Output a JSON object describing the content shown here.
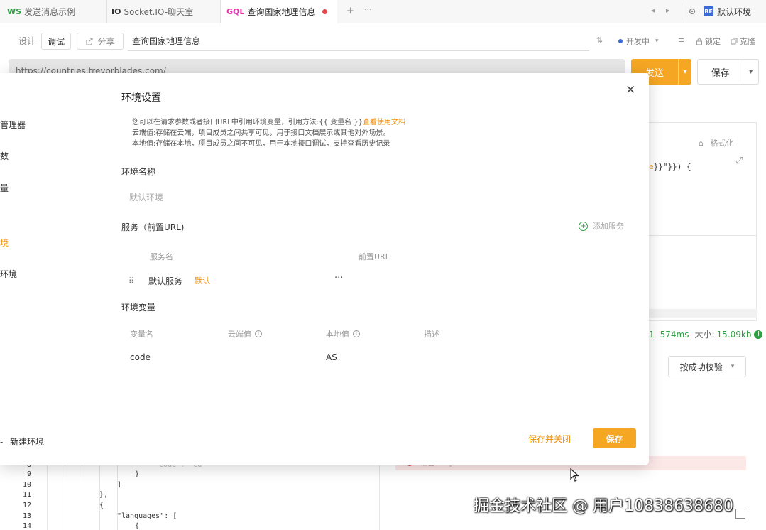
{
  "tabs": [
    {
      "proto": "WS",
      "label": "发送消息示例"
    },
    {
      "proto": "IO",
      "label": "Socket.IO-聊天室"
    },
    {
      "proto": "GQL",
      "label": "查询国家地理信息"
    }
  ],
  "tabbar": {
    "add": "+",
    "more": "···",
    "prev": "◂",
    "next": "▸",
    "env_badge": "BE",
    "env_label": "默认环境"
  },
  "toolbar": {
    "design": "设计",
    "debug": "调试",
    "share": "分享",
    "request_name": "查询国家地理信息",
    "env": "开发中",
    "lock": "锁定",
    "clone": "克隆"
  },
  "url": {
    "value": "https://countries.trevorblades.com/"
  },
  "actions": {
    "send": "发送",
    "save": "保存"
  },
  "bg_right": {
    "format": "格式化",
    "code_fragment_orange": "e",
    "code_fragment_rest": "}}\"}}) {",
    "status_code_tail": "1",
    "time": "574ms",
    "size_label": "大小:",
    "size_value": "15.09kb",
    "validate": "按成功校验"
  },
  "sidebar": {
    "items": [
      {
        "label": "管理器"
      },
      {
        "label": "数"
      },
      {
        "label": "量"
      },
      {
        "label": "境"
      },
      {
        "label": "环境"
      }
    ],
    "new_env": "新建环境"
  },
  "modal": {
    "title": "环境设置",
    "desc_line1": "您可以在请求参数或者接口URL中引用环境变量，引用方法:{{ 变量名 }}",
    "desc_link": "查看使用文档",
    "desc_line2": "云端值:存储在云端，项目成员之间共享可见，用于接口文档展示或其他对外场景。",
    "desc_line3": "本地值:存储在本地，项目成员之间不可见，用于本地接口调试，支持查看历史记录",
    "env_name_label": "环境名称",
    "env_name_value": "默认环境",
    "service_label": "服务（前置URL)",
    "add_service": "添加服务",
    "service_cols": {
      "name": "服务名",
      "url": "前置URL"
    },
    "service_row": {
      "name": "默认服务",
      "tag": "默认"
    },
    "vars_label": "环境变量",
    "var_cols": {
      "name": "变量名",
      "cloud": "云端值",
      "local": "本地值",
      "desc": "描述"
    },
    "var_row": {
      "name": "code",
      "local": "AS"
    },
    "save_close": "保存并关闭",
    "save": "保存"
  },
  "editor": {
    "lines": [
      {
        "n": "8",
        "text": "\"code\": \"cd\""
      },
      {
        "n": "9",
        "text": "}"
      },
      {
        "n": "10",
        "text": "]"
      },
      {
        "n": "11",
        "text": "},"
      },
      {
        "n": "12",
        "text": "{"
      },
      {
        "n": "13",
        "text": "\"languages\": ["
      },
      {
        "n": "14",
        "text": "{"
      }
    ]
  },
  "alert": {
    "text": "断言: expected 514 to be below 200"
  },
  "watermark": "掘金技术社区 @ 用户10838638680",
  "colors": {
    "accent": "#f5a623",
    "success": "#2ea043",
    "error": "#e5484d",
    "gql": "#e535ab"
  }
}
